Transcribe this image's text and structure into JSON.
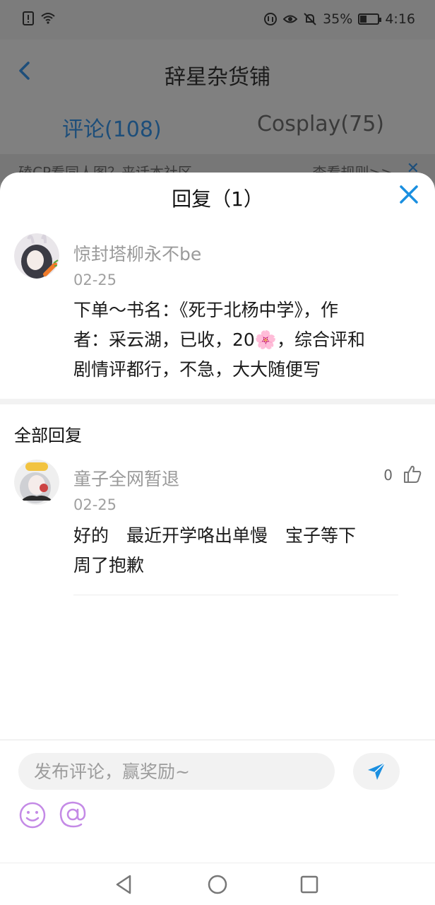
{
  "status_bar": {
    "battery_percent": "35%",
    "battery_level": 0.35,
    "time": "4:16",
    "left_icons": [
      "alert-icon",
      "wifi-icon"
    ],
    "right_icons": [
      "data-icon",
      "eye-icon",
      "mute-icon"
    ]
  },
  "background_page": {
    "title": "辞星杂货铺",
    "tabs": [
      {
        "label": "评论(108)",
        "active": true
      },
      {
        "label": "Cosplay(75)",
        "active": false
      }
    ],
    "notice_text": "磕CP看同人图？来话本社区",
    "notice_link": "查看规则>>",
    "notice_close": "✕"
  },
  "sheet": {
    "title": "回复（1）",
    "original_comment": {
      "username": "惊封塔柳永不be",
      "date": "02-25",
      "text_line1": "下单～书名：《死于北杨中学》，作",
      "text_line2": "者：采云湖，已收，20🌸，综合评和",
      "text_line3": "剧情评都行，不急，大大随便写"
    },
    "section_title": "全部回复",
    "replies": [
      {
        "username": "童子全网暂退",
        "date": "02-25",
        "like_count": "0",
        "text_line1": "好的　最近开学咯出单慢　宝子等下",
        "text_line2": "周了抱歉"
      }
    ]
  },
  "input": {
    "placeholder": "发布评论，赢奖励~",
    "value": ""
  },
  "colors": {
    "accent": "#1a8fe0",
    "dim_overlay": "#7f7f7f",
    "emoji_purple": "#c48ae6"
  }
}
